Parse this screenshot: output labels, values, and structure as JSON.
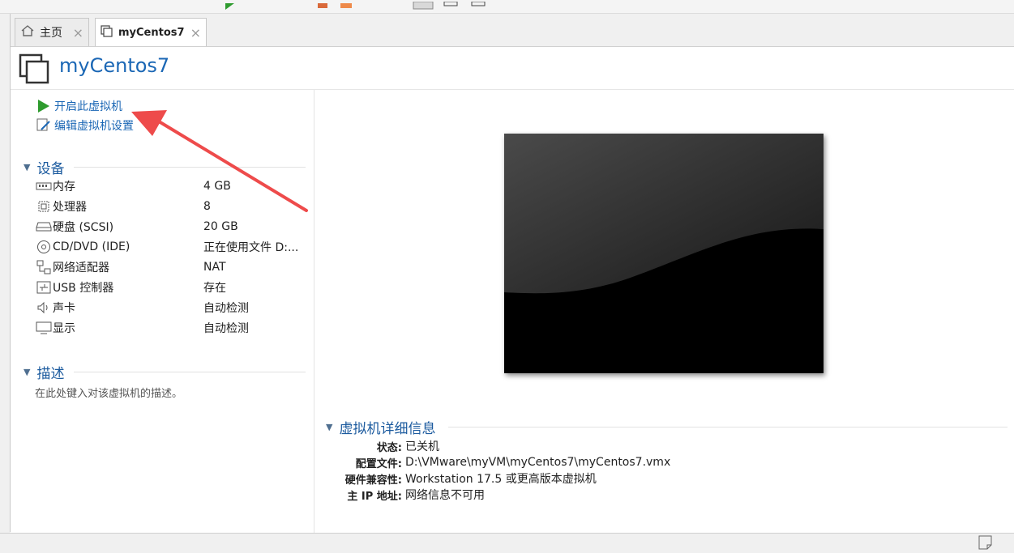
{
  "tabs": [
    {
      "label": "主页",
      "icon": "home-icon"
    },
    {
      "label": "myCentos7",
      "icon": "vm-icon"
    }
  ],
  "tab_close": "×",
  "vm": {
    "title": "myCentos7"
  },
  "actions": [
    {
      "label": "开启此虚拟机",
      "icon": "play-icon"
    },
    {
      "label": "编辑虚拟机设置",
      "icon": "edit-settings-icon"
    }
  ],
  "devices_section": {
    "title": "设备",
    "items": [
      {
        "name": "内存",
        "value": "4 GB",
        "icon": "memory-icon"
      },
      {
        "name": "处理器",
        "value": "8",
        "icon": "cpu-icon"
      },
      {
        "name": "硬盘 (SCSI)",
        "value": "20 GB",
        "icon": "hard-disk-icon"
      },
      {
        "name": "CD/DVD (IDE)",
        "value": "正在使用文件 D:...",
        "icon": "cd-dvd-icon"
      },
      {
        "name": "网络适配器",
        "value": "NAT",
        "icon": "network-adapter-icon"
      },
      {
        "name": "USB 控制器",
        "value": "存在",
        "icon": "usb-icon"
      },
      {
        "name": "声卡",
        "value": "自动检测",
        "icon": "speaker-icon"
      },
      {
        "name": "显示",
        "value": "自动检测",
        "icon": "monitor-icon"
      }
    ]
  },
  "description_section": {
    "title": "描述",
    "placeholder": "在此处键入对该虚拟机的描述。"
  },
  "details_section": {
    "title": "虚拟机详细信息",
    "rows": [
      {
        "key": "状态:",
        "value": "已关机"
      },
      {
        "key": "配置文件:",
        "value": "D:\\VMware\\myVM\\myCentos7\\myCentos7.vmx"
      },
      {
        "key": "硬件兼容性:",
        "value": "Workstation 17.5 或更高版本虚拟机"
      },
      {
        "key": "主 IP 地址:",
        "value": "网络信息不可用"
      }
    ]
  },
  "colors": {
    "accent": "#1b67b5",
    "play": "#2e9b2e",
    "annotation_arrow": "#ee4b4b"
  }
}
